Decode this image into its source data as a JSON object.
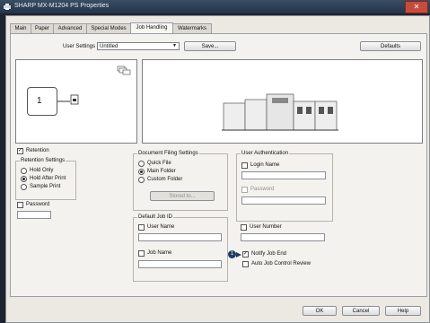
{
  "window": {
    "title": "SHARP MX-M1204 PS Properties",
    "close_icon": "close-icon"
  },
  "tabs": [
    "Main",
    "Paper",
    "Advanced",
    "Special Modes",
    "Job Handling",
    "Watermarks"
  ],
  "active_tab": "Job Handling",
  "user_settings": {
    "label": "User Settings",
    "value": "Untitled",
    "save_label": "Save...",
    "defaults_label": "Defaults"
  },
  "preview": {
    "page_number": "1"
  },
  "retention": {
    "checkbox_label": "Retention",
    "checked": true,
    "group_title": "Retention Settings",
    "options": [
      "Hold Only",
      "Hold After Print",
      "Sample Print"
    ],
    "selected": "Hold After Print",
    "password_label": "Password",
    "password_checked": false
  },
  "document_filing": {
    "group_title": "Document Filing Settings",
    "options": [
      "Quick File",
      "Main Folder",
      "Custom Folder"
    ],
    "selected": "Main Folder",
    "stored_button": "Stored to..."
  },
  "user_auth": {
    "group_title": "User Authentication",
    "login_label": "Login Name",
    "password_label": "Password",
    "user_number_label": "User Number"
  },
  "default_job_id": {
    "group_title": "Default Job ID",
    "user_name_label": "User Name",
    "job_name_label": "Job Name"
  },
  "notify": {
    "badge": "1",
    "notify_label": "Notify Job End",
    "notify_checked": true,
    "auto_label": "Auto Job Control Review",
    "auto_checked": false
  },
  "footer": {
    "ok": "OK",
    "cancel": "Cancel",
    "help": "Help"
  }
}
